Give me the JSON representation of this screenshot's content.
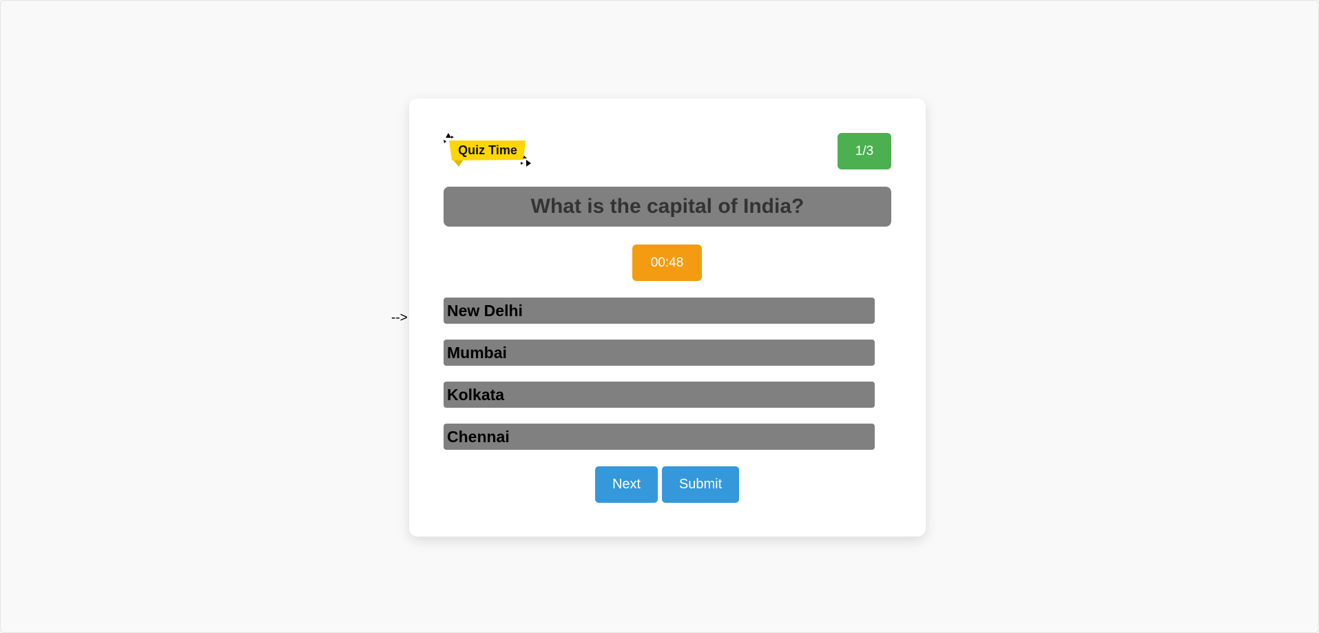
{
  "page": {
    "stray_text": "-->"
  },
  "header": {
    "logo_text": "Quiz Time",
    "progress": "1/3"
  },
  "question": {
    "text": "What is the capital of India?"
  },
  "timer": {
    "value": "00:48"
  },
  "options": [
    {
      "label": "New Delhi"
    },
    {
      "label": "Mumbai"
    },
    {
      "label": "Kolkata"
    },
    {
      "label": "Chennai"
    }
  ],
  "actions": {
    "next_label": "Next",
    "submit_label": "Submit"
  },
  "colors": {
    "background": "#f9f9f9",
    "card": "#ffffff",
    "counter_badge": "#4caf50",
    "question_box": "#808080",
    "question_text": "#333333",
    "timer": "#f39c12",
    "option": "#808080",
    "button": "#3498db",
    "logo_banner": "#ffd600"
  },
  "icons": {
    "logo": "quiz-time-logo"
  }
}
